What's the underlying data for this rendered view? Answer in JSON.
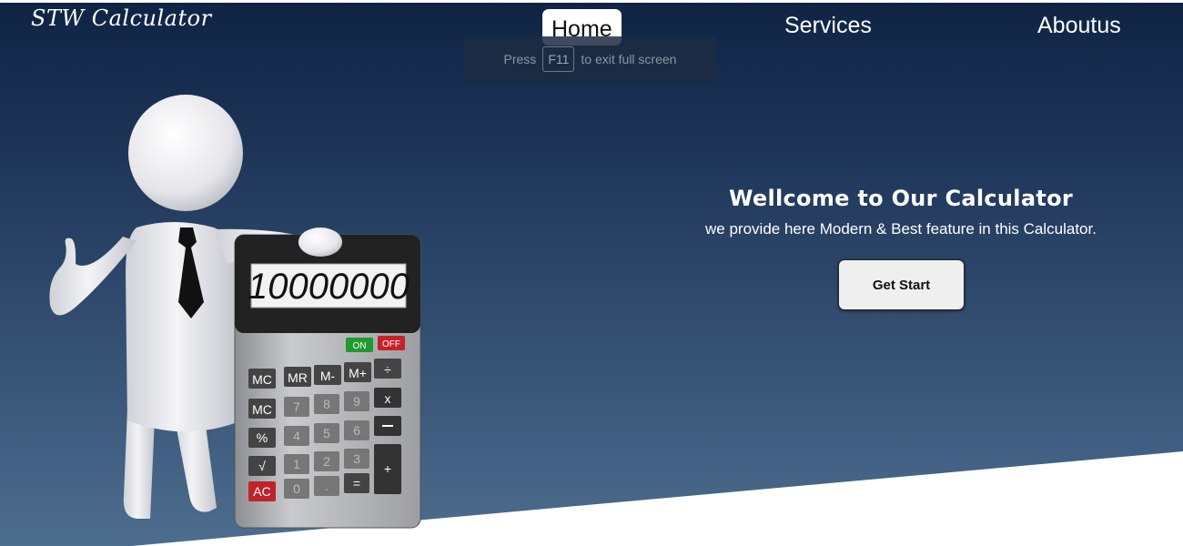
{
  "header": {
    "logo": "STW Calculator",
    "nav": [
      {
        "label": "Home",
        "active": true
      },
      {
        "label": "Services"
      },
      {
        "label": "Aboutus"
      }
    ]
  },
  "fullscreen_hint": {
    "prefix": "Press",
    "key": "F11",
    "suffix": "to exit full screen"
  },
  "hero": {
    "title": "Wellcome to Our Calculator",
    "subtitle": "we provide here Modern & Best feature in this Calculator.",
    "cta_label": "Get Start"
  },
  "calculator": {
    "display": "10000000",
    "on_label": "ON",
    "off_label": "OFF",
    "keys": {
      "mc": "MC",
      "mr": "MR",
      "m_minus": "M-",
      "m_plus": "M+",
      "divide": "÷",
      "mc2": "MC",
      "k7": "7",
      "k8": "8",
      "k9": "9",
      "multiply": "x",
      "percent": "%",
      "k4": "4",
      "k5": "5",
      "k6": "6",
      "sqrt": "√",
      "k1": "1",
      "k2": "2",
      "k3": "3",
      "plus": "+",
      "ac": "AC",
      "k0": "0",
      "dot": ".",
      "equals": "="
    }
  },
  "colors": {
    "hero_top": "#0f2444",
    "hero_bottom": "#4d6d8f",
    "on_green": "#1e9a2e",
    "off_red": "#c8202a",
    "ac_red": "#c0222b"
  }
}
